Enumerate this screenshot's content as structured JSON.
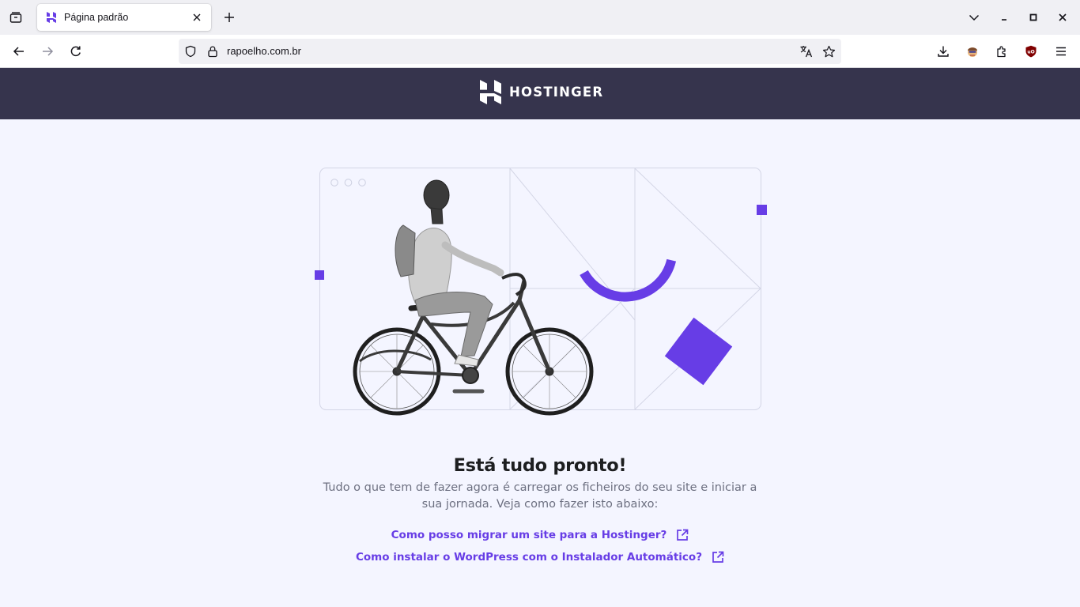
{
  "browser": {
    "tab": {
      "title": "Página padrão"
    },
    "url": "rapoelho.com.br",
    "icons": {
      "tab_list": "tab-list-icon",
      "new_tab": "plus-icon",
      "back": "arrow-left-icon",
      "forward": "arrow-right-icon",
      "reload": "reload-icon",
      "shield": "shield-icon",
      "lock": "lock-icon",
      "translate": "translate-icon",
      "bookmark": "star-icon",
      "downloads": "download-icon",
      "extensions": "puzzle-icon",
      "ublock": "ublock-icon",
      "menu": "hamburger-icon"
    }
  },
  "header": {
    "logo_text": "HOSTINGER"
  },
  "main": {
    "headline": "Está tudo pronto!",
    "subtext": "Tudo o que tem de fazer agora é carregar os ficheiros do seu site e iniciar a sua jornada. Veja como fazer isto abaixo:",
    "links": [
      {
        "label": "Como posso migrar um site para a Hostinger?"
      },
      {
        "label": "Como instalar o WordPress com o Instalador Automático?"
      }
    ]
  },
  "colors": {
    "header_bg": "#36344d",
    "page_bg": "#f4f5ff",
    "accent": "#673de6",
    "headline": "#1d1e20",
    "body_text": "#6d7081"
  }
}
